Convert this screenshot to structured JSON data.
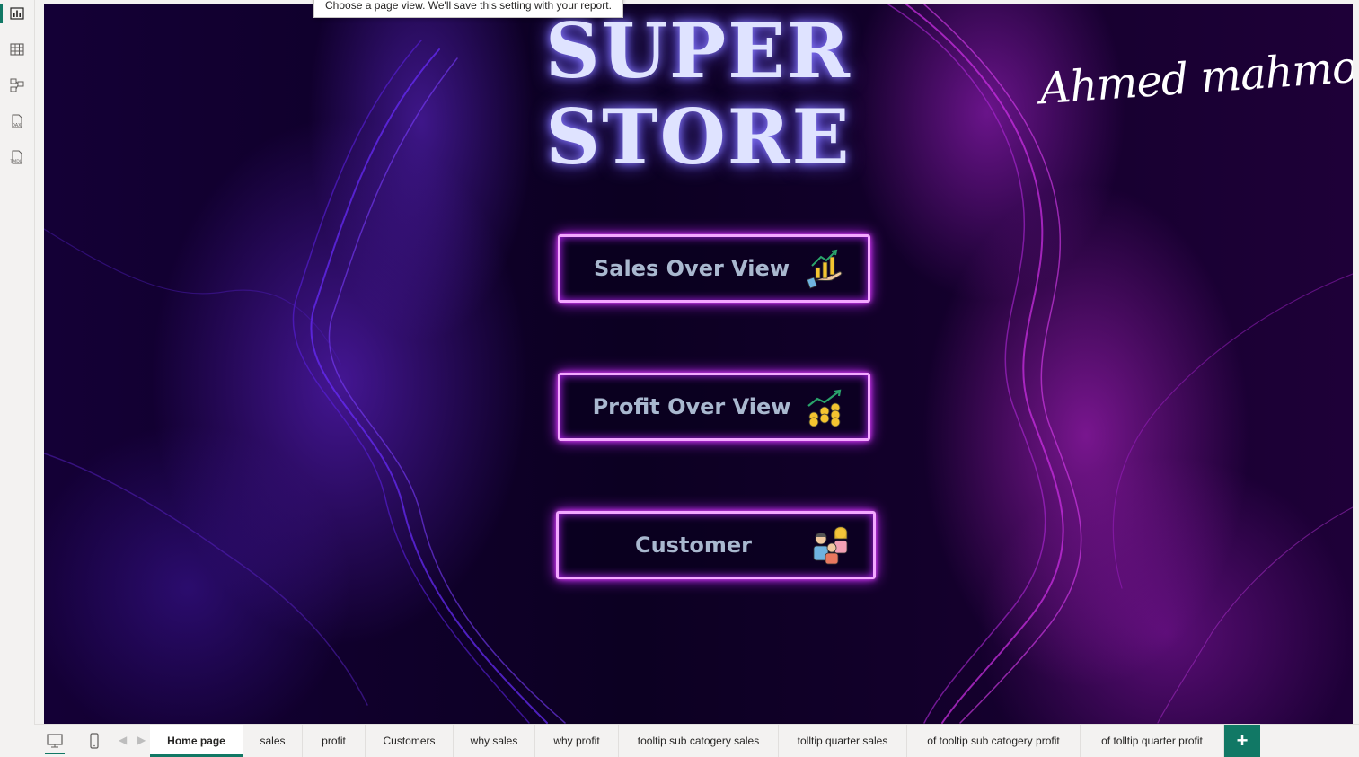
{
  "report": {
    "title_line1": "SUPER",
    "title_line2": "STORE",
    "signature": "Ahmed mahmoud",
    "accent": "#f3a8ff",
    "background": "#0c0022"
  },
  "buttons": [
    {
      "label": "Sales Over View",
      "icon": "sales-growth-icon"
    },
    {
      "label": "Profit Over View",
      "icon": "profit-growth-icon"
    },
    {
      "label": "Customer",
      "icon": "customers-icon"
    }
  ],
  "tooltip": "Choose a page view. We'll save this setting with your report.",
  "rail": [
    "report-view-icon",
    "table-view-icon",
    "model-view-icon",
    "dax-query-icon",
    "tmdl-view-icon"
  ],
  "tabs": [
    {
      "label": "Home page",
      "active": true
    },
    {
      "label": "sales"
    },
    {
      "label": "profit"
    },
    {
      "label": "Customers"
    },
    {
      "label": "why sales"
    },
    {
      "label": "why profit"
    },
    {
      "label": "tooltip sub catogery sales"
    },
    {
      "label": "tolltip quarter sales"
    },
    {
      "label": "of tooltip sub catogery profit"
    },
    {
      "label": "of tolltip quarter profit"
    }
  ],
  "add_tab": "+",
  "theme_color": "#117865"
}
